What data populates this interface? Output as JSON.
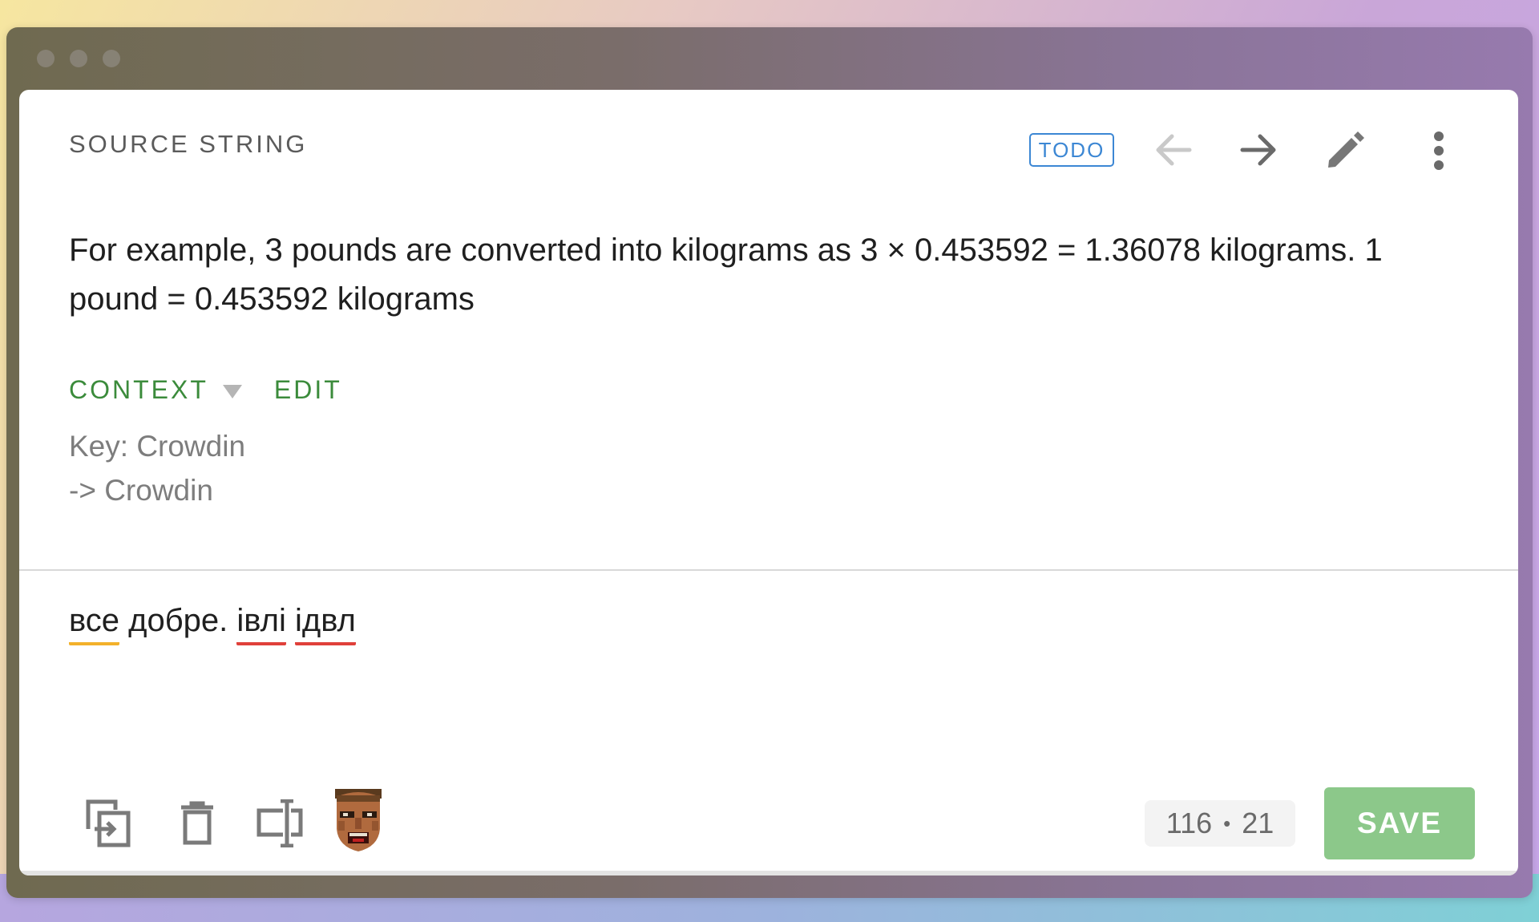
{
  "header": {
    "title": "SOURCE STRING",
    "status_badge": "TODO",
    "icons": [
      "arrow-left-icon",
      "arrow-right-icon",
      "pencil-icon",
      "more-vertical-icon"
    ]
  },
  "source": {
    "text_line1": "For example, 3 pounds are converted into kilograms as 3 × 0.453592 = 1.36078 kilograms. 1",
    "text_line2": "pound = 0.453592 kilograms"
  },
  "context": {
    "label": "CONTEXT",
    "edit_label": "EDIT",
    "lines": [
      "Key: Crowdin",
      "-> Crowdin"
    ]
  },
  "translation": {
    "words": [
      "все",
      "добре.",
      "івлі",
      "ідвл"
    ]
  },
  "toolbar": {
    "icons": [
      "copy-source-icon",
      "trash-icon",
      "text-cursor-icon",
      "doom-face-avatar"
    ],
    "counter_left": "116",
    "counter_separator": "•",
    "counter_right": "21",
    "save_label": "SAVE"
  },
  "colors": {
    "accent_green": "#3b8b3b",
    "save_green": "#8cc88a",
    "todo_blue": "#3c87d4",
    "spell_warning": "#f3b12a",
    "spell_error": "#e0403a"
  }
}
